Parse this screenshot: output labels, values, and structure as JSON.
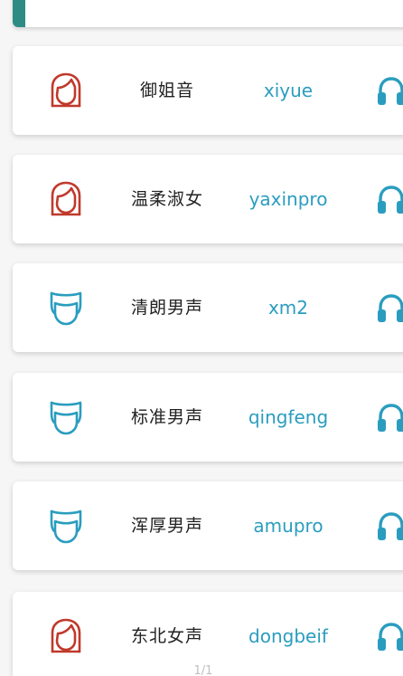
{
  "colors": {
    "female_icon": "#c0392b",
    "male_icon": "#2a9dbf",
    "code_text": "#2a9dbf",
    "accent": "#2e8b84"
  },
  "voices": [
    {
      "name": "御姐音",
      "code": "xiyue",
      "gender": "female",
      "avatar_icon": "female-avatar-icon",
      "action_icon": "headphones-icon"
    },
    {
      "name": "温柔淑女",
      "code": "yaxinpro",
      "gender": "female",
      "avatar_icon": "female-avatar-icon",
      "action_icon": "headphones-icon"
    },
    {
      "name": "清朗男声",
      "code": "xm2",
      "gender": "male",
      "avatar_icon": "male-avatar-icon",
      "action_icon": "headphones-icon"
    },
    {
      "name": "标准男声",
      "code": "qingfeng",
      "gender": "male",
      "avatar_icon": "male-avatar-icon",
      "action_icon": "headphones-icon"
    },
    {
      "name": "浑厚男声",
      "code": "amupro",
      "gender": "male",
      "avatar_icon": "male-avatar-icon",
      "action_icon": "headphones-icon"
    },
    {
      "name": "东北女声",
      "code": "dongbeif",
      "gender": "female",
      "avatar_icon": "female-avatar-icon",
      "action_icon": "headphones-icon"
    }
  ],
  "pager": {
    "text": "1/1"
  }
}
